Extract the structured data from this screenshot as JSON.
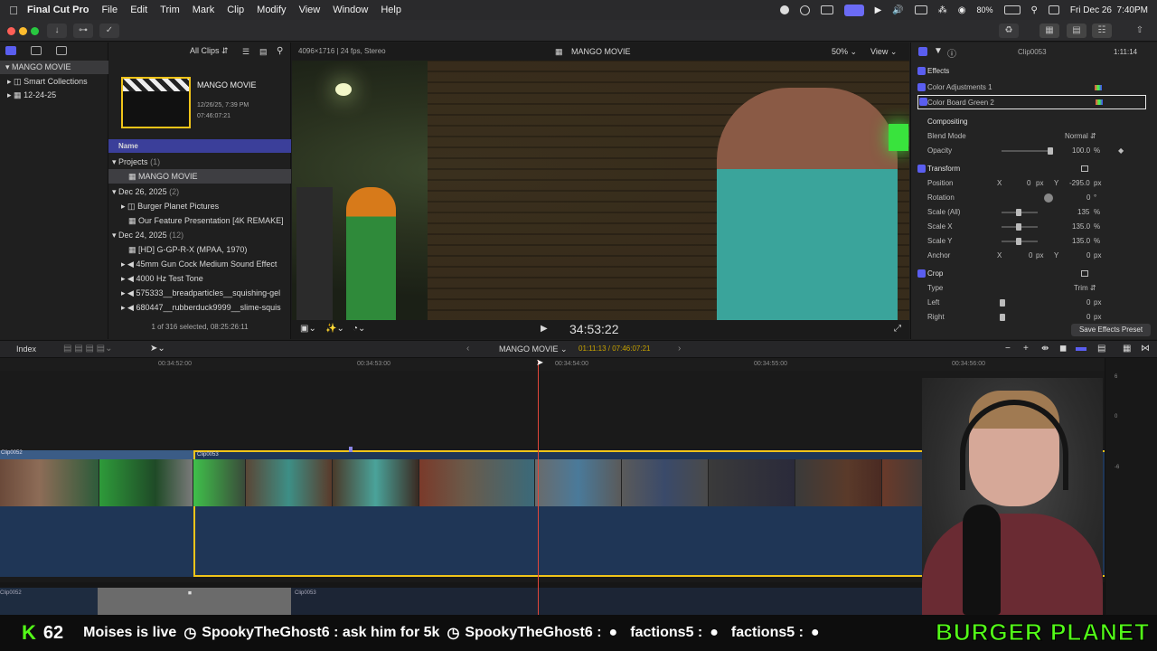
{
  "menubar": {
    "app_name": "Final Cut Pro",
    "items": [
      "File",
      "Edit",
      "Trim",
      "Mark",
      "Clip",
      "Modify",
      "View",
      "Window",
      "Help"
    ],
    "battery": "80%",
    "datetime": "Fri Dec 26  7:40PM"
  },
  "library": {
    "items": [
      {
        "label": "MANGO MOVIE"
      },
      {
        "label": "Smart Collections"
      },
      {
        "label": "12-24-25"
      }
    ]
  },
  "browser": {
    "filter": "All Clips",
    "project_card": {
      "title": "MANGO MOVIE",
      "date": "12/26/25, 7:39 PM",
      "duration": "07:46:07:21"
    },
    "column_header": "Name",
    "rows": [
      {
        "label": "Projects",
        "count": "(1)",
        "type": "group"
      },
      {
        "label": "MANGO MOVIE",
        "type": "item-selected"
      },
      {
        "label": "Dec 26, 2025",
        "count": "(2)",
        "type": "group"
      },
      {
        "label": "Burger Planet Pictures",
        "type": "item"
      },
      {
        "label": "Our Feature Presentation [4K REMAKE]",
        "type": "item"
      },
      {
        "label": "Dec 24, 2025",
        "count": "(12)",
        "type": "group"
      },
      {
        "label": "[HD] G-GP-R-X (MPAA, 1970)",
        "type": "item"
      },
      {
        "label": "45mm Gun Cock Medium Sound Effect",
        "type": "item"
      },
      {
        "label": "4000 Hz Test Tone",
        "type": "item"
      },
      {
        "label": "575333__breadparticles__squishing-gel",
        "type": "item"
      },
      {
        "label": "680447__rubberduck9999__slime-squis",
        "type": "item"
      }
    ],
    "status": "1 of 316 selected, 08:25:26:11"
  },
  "viewer": {
    "format": "4096×1716 | 24 fps, Stereo",
    "title": "MANGO MOVIE",
    "zoom": "50%",
    "view_menu": "View",
    "timecode": "34:53:22"
  },
  "inspector": {
    "clip_name": "Clip0053",
    "duration": "1:11:14",
    "effects_heading": "Effects",
    "effects": [
      "Color Adjustments 1",
      "Color Board Green 2"
    ],
    "compositing_heading": "Compositing",
    "blend_mode_label": "Blend Mode",
    "blend_mode_value": "Normal",
    "opacity_label": "Opacity",
    "opacity_value": "100.0",
    "opacity_unit": "%",
    "transform_heading": "Transform",
    "position_label": "Position",
    "position_x": "0",
    "position_y": "-295.0",
    "rotation_label": "Rotation",
    "rotation_value": "0",
    "scale_all_label": "Scale (All)",
    "scale_all_value": "135",
    "scale_x_label": "Scale X",
    "scale_x_value": "135.0",
    "scale_y_label": "Scale Y",
    "scale_y_value": "135.0",
    "anchor_label": "Anchor",
    "anchor_x": "0",
    "anchor_y": "0",
    "crop_heading": "Crop",
    "type_label": "Type",
    "type_value": "Trim",
    "left_label": "Left",
    "left_value": "0",
    "right_label": "Right",
    "right_value": "0",
    "unit_px": "px",
    "unit_deg": "°",
    "axis_x": "X",
    "axis_y": "Y",
    "save_preset": "Save Effects Preset"
  },
  "timeline": {
    "index_label": "Index",
    "project_name": "MANGO MOVIE",
    "position": "01:11:13 / 07:46:07:21",
    "ruler": [
      "00:34:52:00",
      "00:34:53:00",
      "00:34:54:00",
      "00:34:55:00",
      "00:34:56:00"
    ],
    "clip_left": "Clip0052",
    "clip_right": "Clip0053",
    "audio_left": "Clip0052",
    "audio_right": "Clip0053",
    "meter_labels": [
      "6",
      "0",
      "-6"
    ]
  },
  "ticker": {
    "viewer_count": "62",
    "messages": [
      "Moises is live",
      "SpookyTheGhost6 : ask him for 5k",
      "SpookyTheGhost6 :",
      "factions5 :",
      "factions5 :"
    ],
    "brand": "BURGER PLANET"
  },
  "colors": {
    "accent": "#5a5ef0",
    "storyline": "#1f3656",
    "playhead": "#e0463a",
    "selection": "#f0c419"
  }
}
